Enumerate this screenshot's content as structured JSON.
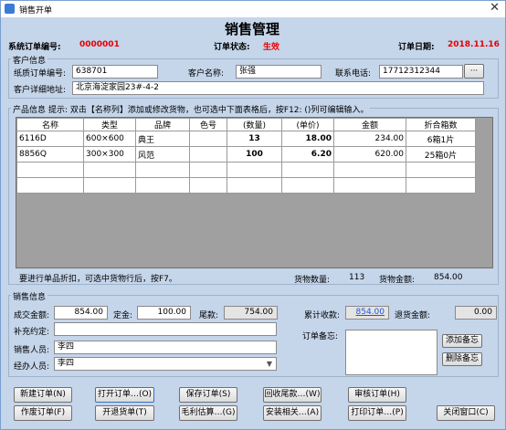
{
  "window": {
    "title": "销售开单",
    "close_icon": "✕"
  },
  "header": {
    "main_title": "销售管理",
    "order_no_label": "系统订单编号:",
    "order_no_value": "0000001",
    "status_label": "订单状态:",
    "status_value": "生效",
    "date_label": "订单日期:",
    "date_value": "2018.11.16"
  },
  "customer": {
    "section_title": "客户信息",
    "paper_no_label": "纸质订单编号:",
    "paper_no_value": "638701",
    "name_label": "客户名称:",
    "name_value": "张强",
    "phone_label": "联系电话:",
    "phone_value": "17712312344",
    "phone_btn": "···",
    "address_label": "客户详细地址:",
    "address_value": "北京海淀家园23#-4-2"
  },
  "products": {
    "hint_title": "产品信息",
    "hint": "提示: 双击【名称列】添加或修改货物，也可选中下面表格后，按F12: ()列可编辑输入。",
    "columns": [
      "名称",
      "类型",
      "品牌",
      "色号",
      "(数量)",
      "(单价)",
      "金额",
      "折合箱数"
    ],
    "rows": [
      [
        "6116D",
        "600×600",
        "典王",
        "",
        "13",
        "18.00",
        "234.00",
        "6箱1片"
      ],
      [
        "8856Q",
        "300×300",
        "风范",
        "",
        "100",
        "6.20",
        "620.00",
        "25箱0片"
      ]
    ],
    "empty_rows": 2,
    "discount_hint": "要进行单品折扣，可选中货物行后，按F7。",
    "qty_label": "货物数量:",
    "qty_value": "113",
    "total_label": "货物金额:",
    "total_value": "854.00"
  },
  "sales": {
    "section_title": "销售信息",
    "deal_label": "成交金额:",
    "deal_value": "854.00",
    "deposit_label": "定金:",
    "deposit_value": "100.00",
    "balance_label": "尾款:",
    "balance_value": "754.00",
    "received_label": "累计收款:",
    "received_value": "854.00",
    "refund_label": "退货金额:",
    "refund_value": "0.00",
    "agreement_label": "补充约定:",
    "agreement_value": "",
    "salesperson_label": "销售人员:",
    "salesperson_value": "李四",
    "handler_label": "经办人员:",
    "handler_value": "李四",
    "remark_label": "订单备忘:",
    "remark_value": "",
    "add_remark_btn": "添加备忘",
    "delete_remark_btn": "删除备忘"
  },
  "buttons": {
    "new_order": "新建订单(N)",
    "open_order": "打开订单…(O)",
    "save_order": "保存订单(S)",
    "collect_balance": "回收尾款…(W)",
    "review_order": "审核订单(H)",
    "void_order": "作废订单(F)",
    "open_return": "开退货单(T)",
    "gross_profit": "毛利估算…(G)",
    "install": "安装相关…(A)",
    "print_order": "打印订单…(P)",
    "close_window": "关闭窗口(C)"
  }
}
